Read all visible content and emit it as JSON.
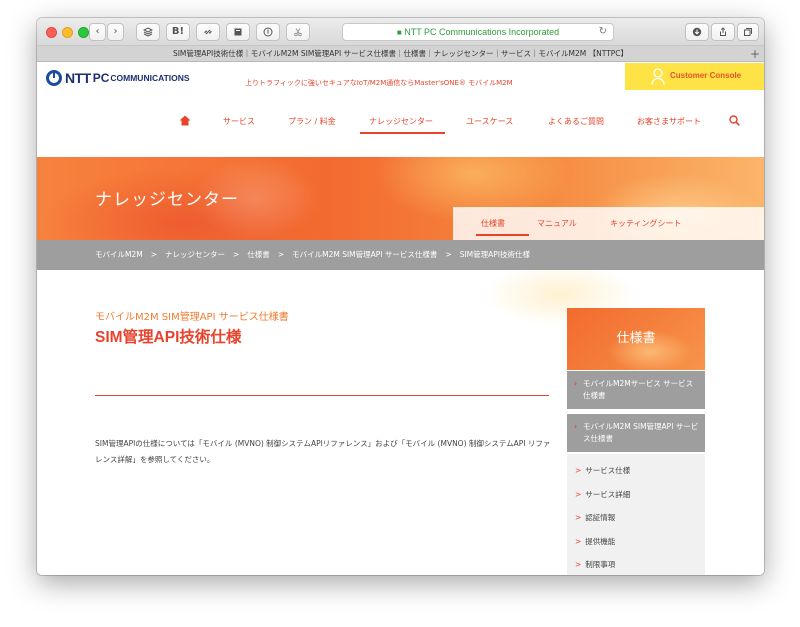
{
  "browser": {
    "url": "NTT PC Communications Incorporated",
    "tab_title": "SIM管理API技術仕様｜モバイルM2M SIM管理API サービス仕様書｜仕様書｜ナレッジセンター｜サービス｜モバイルM2M 【NTTPC】",
    "reader_label": "B!"
  },
  "header": {
    "logo_ntt": "NTT",
    "logo_pc": "PC",
    "logo_comm": "COMMUNICATIONS",
    "tagline": "上りトラフィックに強いセキュアなIoT/M2M通信ならMaster'sONE® モバイルM2M",
    "console_label": "Customer Console"
  },
  "nav": {
    "items": [
      "サービス",
      "プラン / 料金",
      "ナレッジセンター",
      "ユースケース",
      "よくあるご質問",
      "お客さまサポート"
    ]
  },
  "banner": {
    "title": "ナレッジセンター",
    "subtabs": [
      "仕様書",
      "マニュアル",
      "キッティングシート"
    ]
  },
  "breadcrumb": [
    "モバイルM2M",
    "ナレッジセンター",
    "仕様書",
    "モバイルM2M SIM管理API サービス仕様書",
    "SIM管理API技術仕様"
  ],
  "breadcrumb_separator": ">",
  "main": {
    "kicker": "モバイルM2M SIM管理API サービス仕様書",
    "title": "SIM管理API技術仕様",
    "paragraph": "SIM管理APIの仕様については「モバイル (MVNO) 制御システムAPIリファレンス」および「モバイル (MVNO) 制御システムAPI リファレンス詳解」を参照してください。"
  },
  "sidebar": {
    "heading": "仕様書",
    "groups": [
      "モバイルM2Mサービス サービス仕様書",
      "モバイルM2M SIM管理API サービス仕様書"
    ],
    "items": [
      "サービス仕様",
      "サービス詳細",
      "認証情報",
      "提供機能",
      "制限事項"
    ],
    "item_marker": ">"
  },
  "colors": {
    "brand_red": "#e8432c",
    "brand_orange": "#f07b2f",
    "console_yellow": "#fde345",
    "breadcrumb_gray": "#9e9e9e"
  }
}
